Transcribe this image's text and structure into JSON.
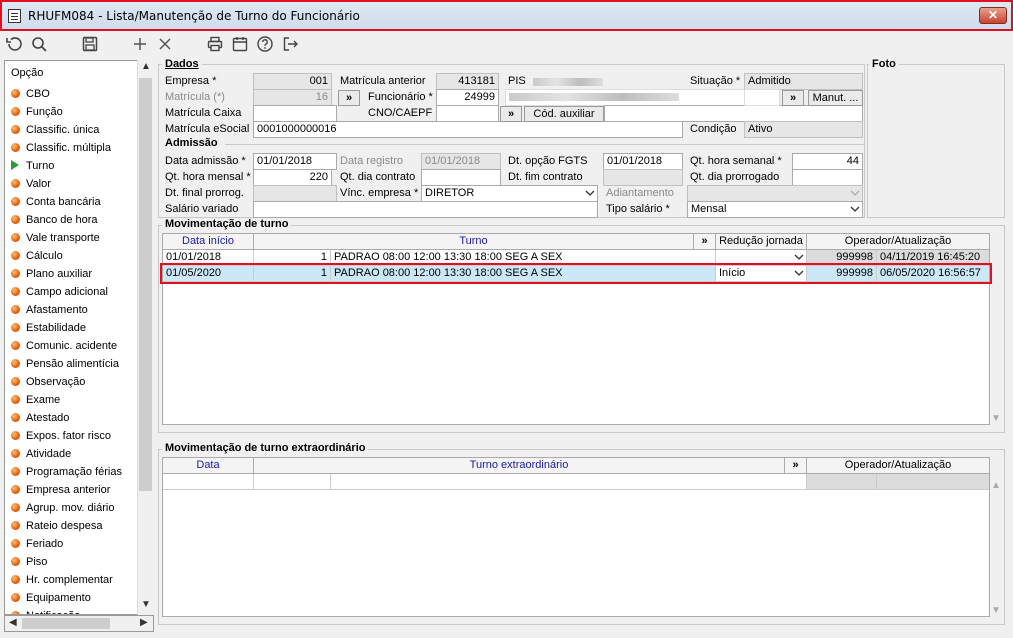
{
  "window": {
    "title": "RHUFM084 - Lista/Manutenção de Turno do Funcionário",
    "close_label": "✕"
  },
  "toolbar": {
    "icons": [
      "undo-icon",
      "search-icon",
      "save-icon",
      "add-icon",
      "delete-icon",
      "print-icon",
      "calendar-icon",
      "help-icon",
      "exit-icon"
    ]
  },
  "sidebar": {
    "header": "Opção",
    "selected": "Turno",
    "items": [
      "CBO",
      "Função",
      "Classific. única",
      "Classific. múltipla",
      "Turno",
      "Valor",
      "Conta bancária",
      "Banco de hora",
      "Vale transporte",
      "Cálculo",
      "Plano auxiliar",
      "Campo adicional",
      "Afastamento",
      "Estabilidade",
      "Comunic. acidente",
      "Pensão alimentícia",
      "Observação",
      "Exame",
      "Atestado",
      "Expos. fator risco",
      "Atividade",
      "Programação férias",
      "Empresa anterior",
      "Agrup. mov. diário",
      "Rateio despesa",
      "Feriado",
      "Piso",
      "Hr. complementar",
      "Equipamento",
      "Notificação"
    ]
  },
  "dados": {
    "section": "Dados",
    "empresa_label": "Empresa *",
    "empresa": "001",
    "matricula_label": "Matrícula (*)",
    "matricula": "16",
    "matricula_caixa_label": "Matrícula Caixa",
    "matricula_esocial_label": "Matrícula eSocial",
    "matricula_esocial": "0001000000016",
    "matricula_anterior_label": "Matrícula anterior",
    "matricula_anterior": "413181",
    "funcionario_label": "Funcionário *",
    "funcionario": "24999",
    "cno_label": "CNO/CAEPF",
    "pis_label": "PIS",
    "situacao_label": "Situação *",
    "situacao": "Admitido",
    "manut_label": "Manut. ...",
    "cod_auxiliar_label": "Cód. auxiliar",
    "condicao_label": "Condição",
    "condicao": "Ativo",
    "expand": "»"
  },
  "foto_label": "Foto",
  "admissao": {
    "section": "Admissão",
    "data_admissao_label": "Data admissão *",
    "data_admissao": "01/01/2018",
    "qt_hora_mensal_label": "Qt. hora mensal *",
    "qt_hora_mensal": "220",
    "dt_final_prorrog_label": "Dt. final prorrog.",
    "salario_variado_label": "Salário variado",
    "data_registro_label": "Data registro",
    "data_registro": "01/01/2018",
    "qt_dia_contrato_label": "Qt. dia contrato",
    "vinc_empresa_label": "Vínc. empresa *",
    "vinc_empresa": "DIRETOR",
    "dt_opcao_fgts_label": "Dt. opção FGTS",
    "dt_opcao_fgts": "01/01/2018",
    "dt_fim_contrato_label": "Dt. fim contrato",
    "adiantamento_label": "Adiantamento",
    "tipo_salario_label": "Tipo salário *",
    "tipo_salario": "Mensal",
    "qt_hora_semanal_label": "Qt. hora semanal *",
    "qt_hora_semanal": "44",
    "qt_dia_prorrogado_label": "Qt. dia prorrogado"
  },
  "movimentacao": {
    "section": "Movimentação de turno",
    "columns": [
      "Data início",
      "Turno",
      "»",
      "Redução jornada",
      "Operador/Atualização"
    ],
    "rows": [
      {
        "data": "01/01/2018",
        "cod": "1",
        "turno": "PADRAO 08:00 12:00 13:30 18:00 SEG A SEX",
        "reducao": "",
        "operador": "999998",
        "atualizacao": "04/11/2019 16:45:20"
      },
      {
        "data": "01/05/2020",
        "cod": "1",
        "turno": "PADRAO 08:00 12:00 13:30 18:00 SEG A SEX",
        "reducao": "Início",
        "operador": "999998",
        "atualizacao": "06/05/2020 16:56:57"
      }
    ]
  },
  "extraordinario": {
    "section": "Movimentação de turno extraordinário",
    "columns": [
      "Data",
      "Turno extraordinário",
      "»",
      "Operador/Atualização"
    ]
  }
}
